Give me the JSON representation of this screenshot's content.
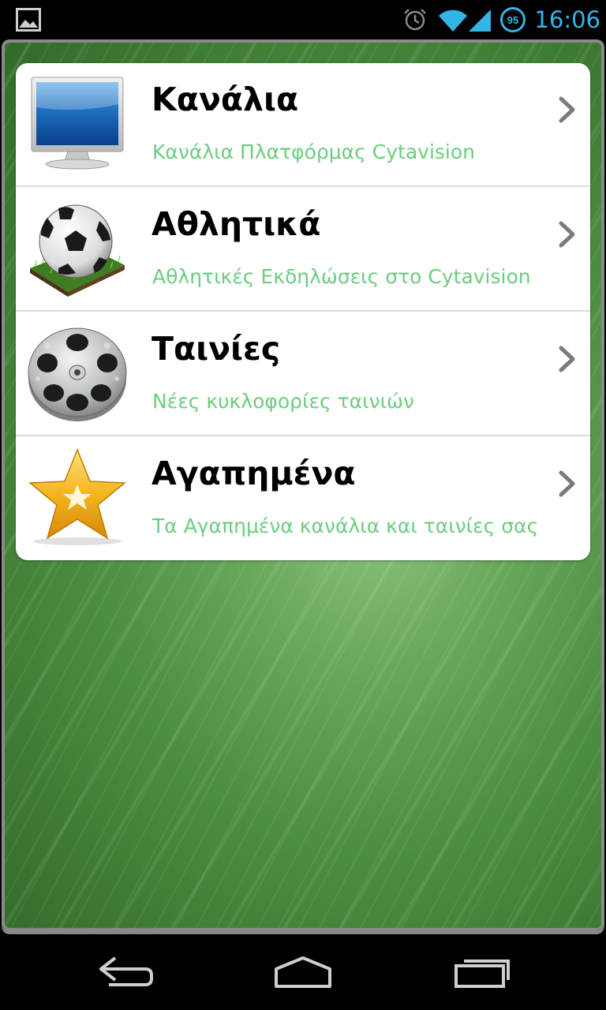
{
  "status_bar": {
    "time": "16:06",
    "battery_level": "95",
    "icons": [
      "gallery-notification-icon",
      "alarm-icon",
      "wifi-icon",
      "cell-signal-icon",
      "battery-icon"
    ]
  },
  "menu": {
    "items": [
      {
        "title": "Κανάλια",
        "subtitle": "Κανάλια Πλατφόρμας Cytavision",
        "icon": "tv-monitor-icon"
      },
      {
        "title": "Αθλητικά",
        "subtitle": "Αθλητικές Εκδηλώσεις στο Cytavision",
        "icon": "soccer-ball-icon"
      },
      {
        "title": "Ταινίες",
        "subtitle": "Νέες κυκλοφορίες ταινιών",
        "icon": "film-reel-icon"
      },
      {
        "title": "Αγαπημένα",
        "subtitle": "Τα Αγαπημένα κανάλια και ταινίες σας",
        "icon": "star-icon"
      }
    ]
  },
  "navigation": {
    "buttons": [
      "back-icon",
      "home-icon",
      "recent-apps-icon"
    ]
  },
  "colors": {
    "accent": "#33b5e5",
    "subtitle": "#6ccd7f",
    "background_green": "#4c8c40"
  }
}
